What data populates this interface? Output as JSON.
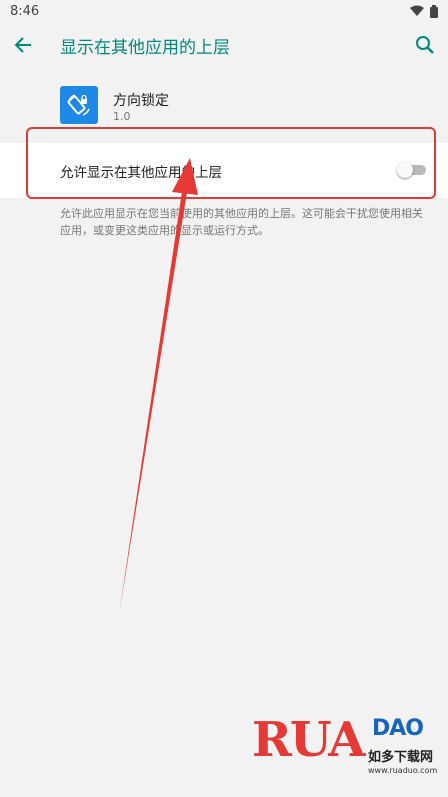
{
  "status_bar": {
    "time": "8:46"
  },
  "app_bar": {
    "title": "显示在其他应用的上层"
  },
  "app_info": {
    "name": "方向锁定",
    "version": "1.0"
  },
  "setting": {
    "label": "允许显示在其他应用的上层",
    "enabled": false
  },
  "description": "允许此应用显示在您当前使用的其他应用的上层。这可能会干扰您使用相关应用，或变更这类应用的显示或运行方式。",
  "watermark": {
    "logo": "RUANDAO",
    "cn": "如多下载网",
    "url": "www.ruaduo.com"
  },
  "colors": {
    "accent": "#00897b",
    "highlight": "#e53935",
    "app_icon": "#1e88e5"
  },
  "icons": {
    "back": "arrow-left-icon",
    "search": "search-icon",
    "wifi": "wifi-icon",
    "battery": "battery-icon"
  }
}
